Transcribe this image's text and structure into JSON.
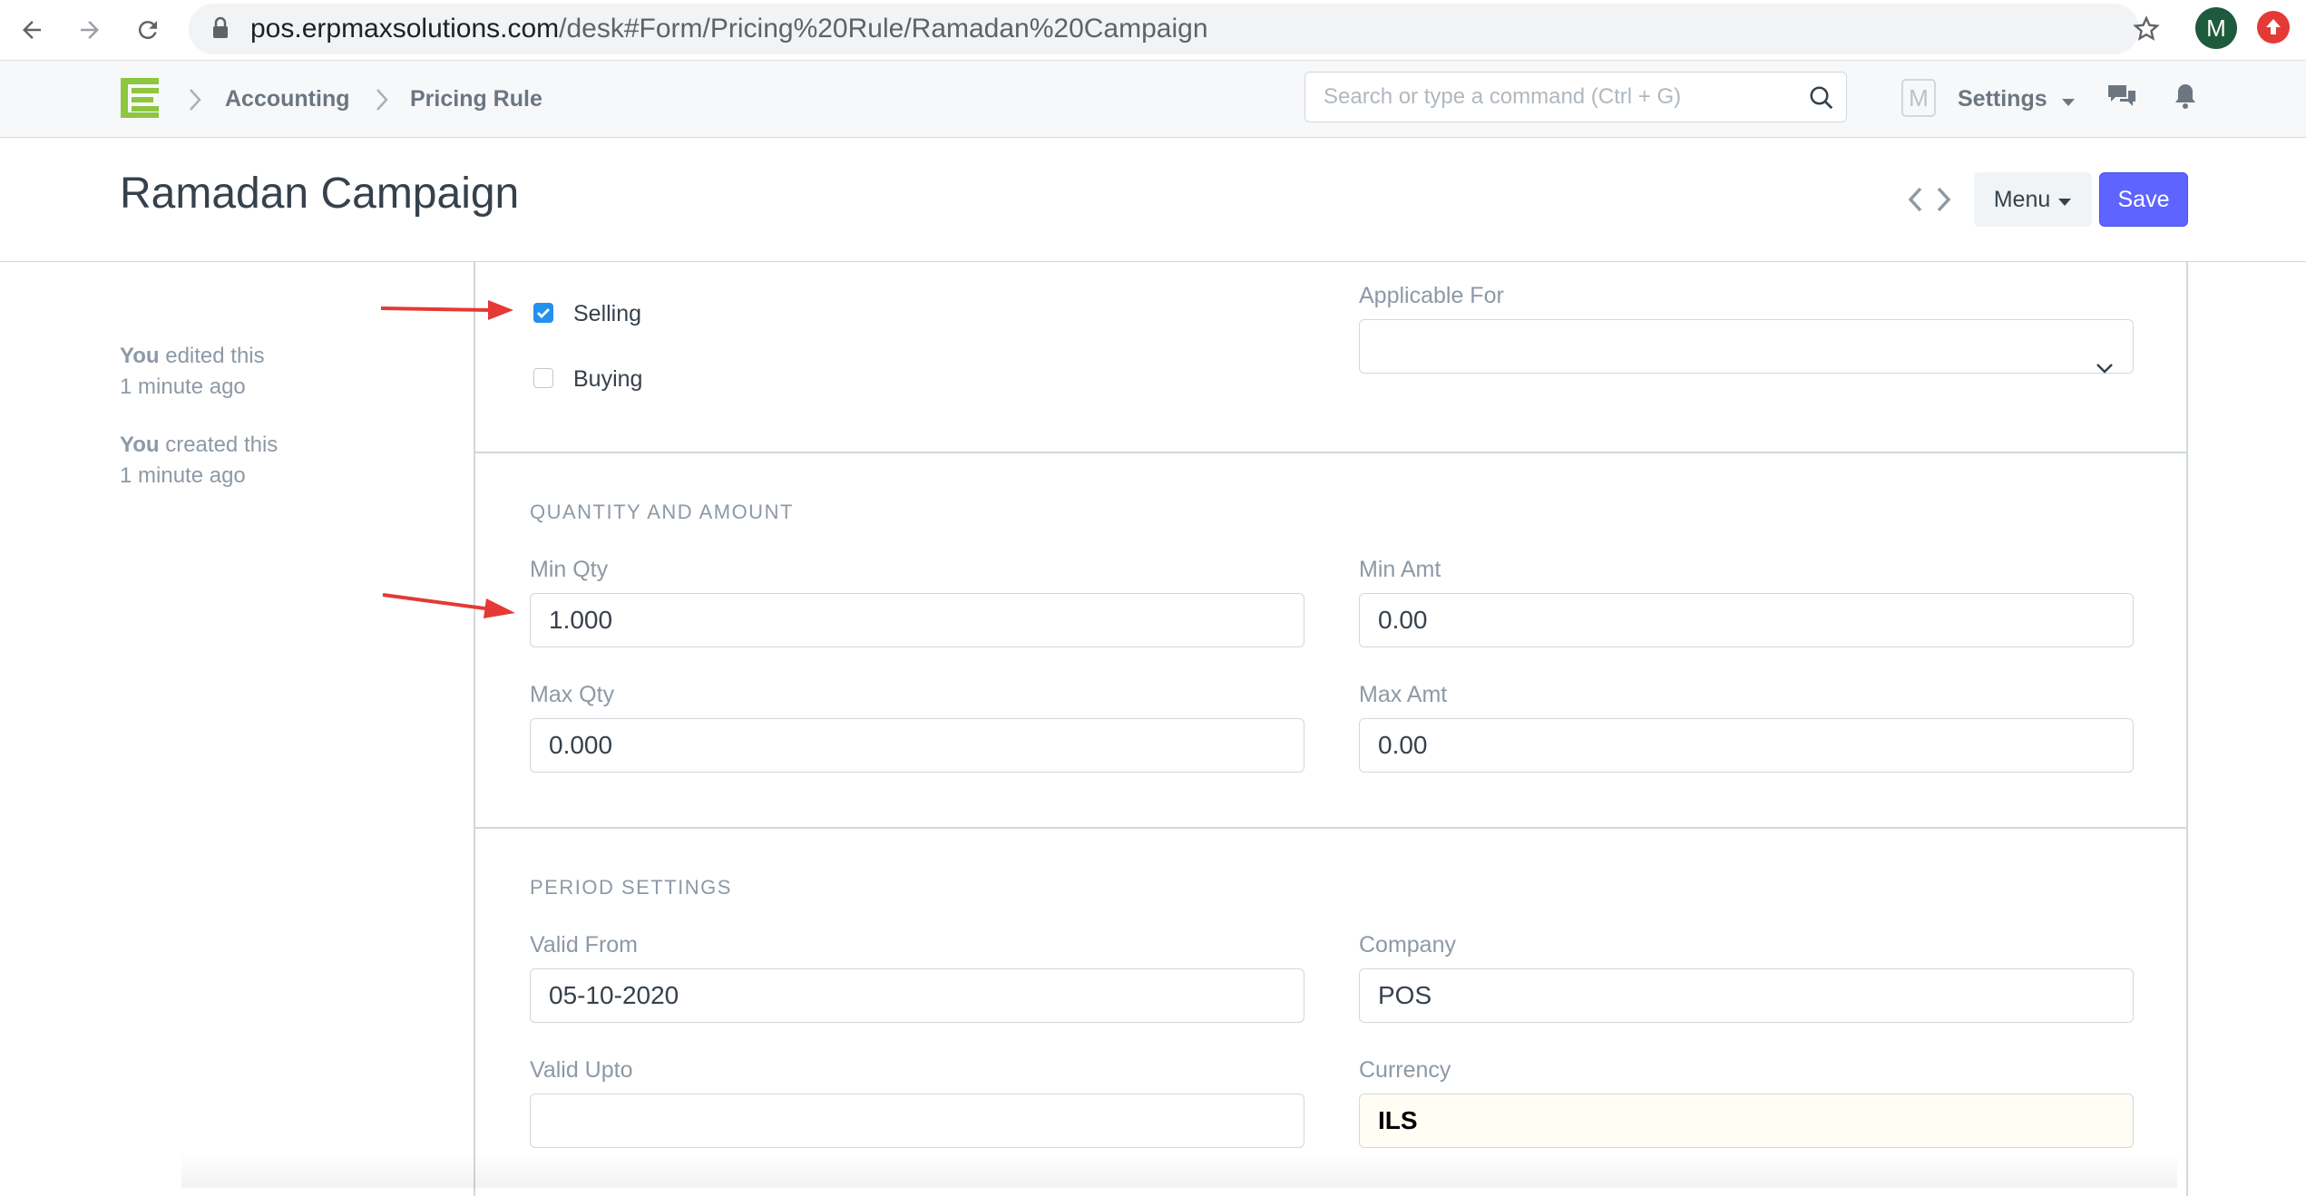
{
  "browser": {
    "url_host": "pos.erpmaxsolutions.com",
    "url_path": "/desk#Form/Pricing%20Rule/Ramadan%20Campaign",
    "profile_initial": "M"
  },
  "navbar": {
    "breadcrumbs": [
      "Accounting",
      "Pricing Rule"
    ],
    "search_placeholder": "Search or type a command (Ctrl + G)",
    "user_initial": "M",
    "settings_label": "Settings"
  },
  "page": {
    "title": "Ramadan Campaign",
    "menu_label": "Menu",
    "save_label": "Save"
  },
  "timeline": [
    {
      "who": "You",
      "action": "edited this",
      "when": "1 minute ago"
    },
    {
      "who": "You",
      "action": "created this",
      "when": "1 minute ago"
    }
  ],
  "form": {
    "selling": {
      "label": "Selling",
      "checked": true
    },
    "buying": {
      "label": "Buying",
      "checked": false
    },
    "applicable_for": {
      "label": "Applicable For",
      "value": ""
    },
    "quantity_section": {
      "title": "QUANTITY AND AMOUNT",
      "min_qty": {
        "label": "Min Qty",
        "value": "1.000"
      },
      "min_amt": {
        "label": "Min Amt",
        "value": "0.00"
      },
      "max_qty": {
        "label": "Max Qty",
        "value": "0.000"
      },
      "max_amt": {
        "label": "Max Amt",
        "value": "0.00"
      }
    },
    "period_section": {
      "title": "PERIOD SETTINGS",
      "valid_from": {
        "label": "Valid From",
        "value": "05-10-2020"
      },
      "company": {
        "label": "Company",
        "value": "POS"
      },
      "valid_upto": {
        "label": "Valid Upto",
        "value": ""
      },
      "currency": {
        "label": "Currency",
        "value": "ILS"
      }
    }
  },
  "colors": {
    "primary": "#5e64ff",
    "annotation_arrow": "#e53935",
    "logo_green": "#8dc63f",
    "checkbox_checked": "#2490ef"
  }
}
